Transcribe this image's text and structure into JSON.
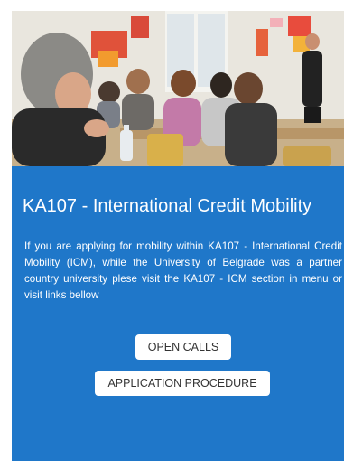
{
  "hero": {
    "image_description_icon": "classroom-photo"
  },
  "section": {
    "title": "KA107 - International Credit Mobility",
    "description": "If you are applying for mobility within KA107 - International Credit Mobility (ICM), while the University of Belgrade was a partner country university plese visit the KA107 - ICM section in menu or visit links bellow"
  },
  "buttons": {
    "open_calls": "OPEN CALLS",
    "application_procedure": "APPLICATION PROCEDURE"
  },
  "colors": {
    "panel_background": "#1f77c9",
    "button_background": "#ffffff",
    "text": "#ffffff"
  }
}
